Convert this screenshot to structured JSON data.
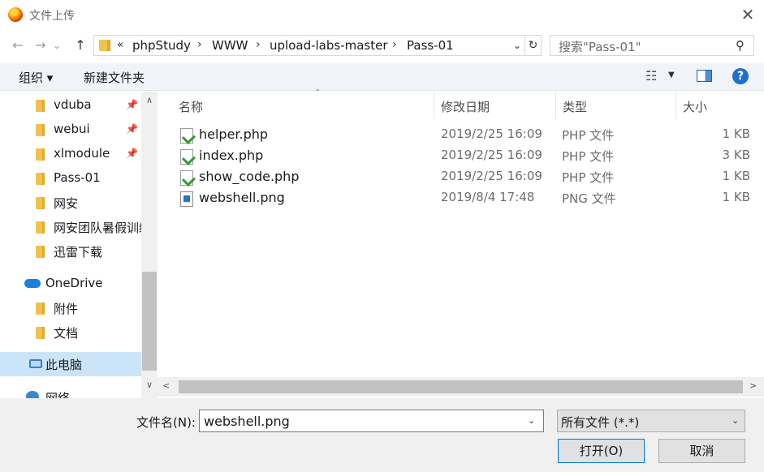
{
  "window": {
    "title": "文件上传",
    "close_glyph": "✕"
  },
  "nav": {
    "back_glyph": "←",
    "forward_glyph": "→",
    "dropdown_glyph": "⌄",
    "up_glyph": "↑",
    "address_prefix": "«",
    "breadcrumbs": [
      "phpStudy",
      "WWW",
      "upload-labs-master",
      "Pass-01"
    ],
    "separator": "›",
    "addr_dropdown_glyph": "⌄",
    "refresh_glyph": "↻",
    "search_placeholder": "搜索\"Pass-01\"",
    "search_glyph": "⚲"
  },
  "toolbar": {
    "organize_label": "组织 ▾",
    "new_folder_label": "新建文件夹",
    "view_glyph": "☷",
    "view_dropdown_glyph": "▼",
    "help_glyph": "?"
  },
  "sidebar": {
    "items": [
      {
        "label": "vduba",
        "pinned": true
      },
      {
        "label": "webui",
        "pinned": true
      },
      {
        "label": "xlmodule",
        "pinned": true
      },
      {
        "label": "Pass-01"
      },
      {
        "label": "网安"
      },
      {
        "label": "网安团队暑假训练"
      },
      {
        "label": "迅雷下载"
      },
      {
        "label": "OneDrive"
      },
      {
        "label": "附件"
      },
      {
        "label": "文档"
      },
      {
        "label": "此电脑"
      },
      {
        "label": "网络"
      }
    ],
    "pin_glyph": "📌",
    "scroll_up_glyph": "∧",
    "scroll_down_glyph": "∨"
  },
  "file_list": {
    "columns": [
      "名称",
      "修改日期",
      "类型",
      "大小"
    ],
    "sort_glyph": "⌃",
    "files": [
      {
        "name": "helper.php",
        "modified": "2019/2/25 16:09",
        "type": "PHP 文件",
        "size": "1 KB",
        "icon": "php-file-icon"
      },
      {
        "name": "index.php",
        "modified": "2019/2/25 16:09",
        "type": "PHP 文件",
        "size": "3 KB",
        "icon": "php-file-icon"
      },
      {
        "name": "show_code.php",
        "modified": "2019/2/25 16:09",
        "type": "PHP 文件",
        "size": "1 KB",
        "icon": "php-file-icon"
      },
      {
        "name": "webshell.png",
        "modified": "2019/8/4 17:48",
        "type": "PNG 文件",
        "size": "1 KB",
        "icon": "png-file-icon"
      }
    ],
    "hscroll_left_glyph": "<",
    "hscroll_right_glyph": ">"
  },
  "footer": {
    "filename_label": "文件名(N):",
    "filename_value": "webshell.png",
    "filetype_value": "所有文件 (*.*)",
    "dropdown_glyph": "⌄",
    "open_label": "打开(O)",
    "cancel_label": "取消"
  },
  "colors": {
    "accent": "#0078d7",
    "selection": "#cce4f7",
    "toolbar_bg": "#f0f4f9",
    "bottom_bg": "#f0f0f0"
  }
}
